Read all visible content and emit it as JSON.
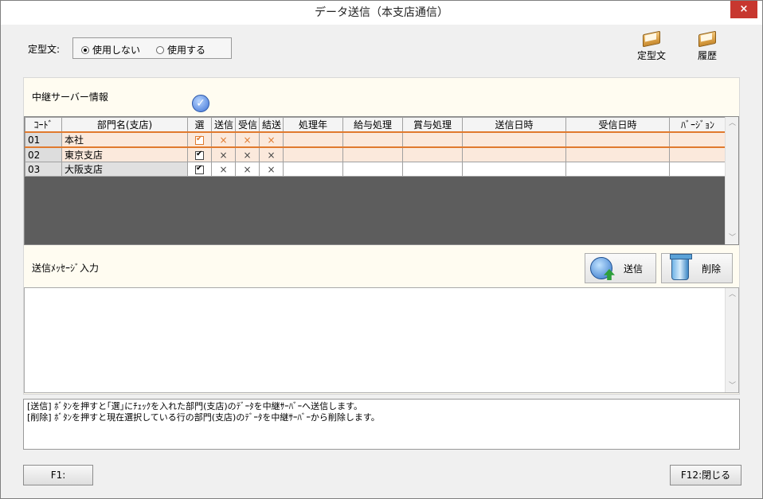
{
  "window": {
    "title": "データ送信（本支店通信）",
    "close": "×"
  },
  "teikei": {
    "label": "定型文:",
    "options": [
      {
        "label": "使用しない",
        "selected": true
      },
      {
        "label": "使用する",
        "selected": false
      }
    ]
  },
  "toolbar": {
    "template_label": "定型文",
    "history_label": "履歴"
  },
  "relay": {
    "title": "中継サーバー情報",
    "columns": [
      "ｺｰﾄﾞ",
      "部門名(支店)",
      "選",
      "送信",
      "受信",
      "結送",
      "処理年",
      "給与処理",
      "賞与処理",
      "送信日時",
      "受信日時",
      "ﾊﾞｰｼﾞｮﾝ"
    ],
    "rows": [
      {
        "code": "01",
        "name": "本社",
        "sel": true,
        "send": "×",
        "recv": "×",
        "result": "×",
        "year": "",
        "salary": "",
        "bonus": "",
        "sent_at": "",
        "recv_at": "",
        "version": ""
      },
      {
        "code": "02",
        "name": "東京支店",
        "sel": true,
        "send": "×",
        "recv": "×",
        "result": "×",
        "year": "",
        "salary": "",
        "bonus": "",
        "sent_at": "",
        "recv_at": "",
        "version": ""
      },
      {
        "code": "03",
        "name": "大阪支店",
        "sel": true,
        "send": "×",
        "recv": "×",
        "result": "×",
        "year": "",
        "salary": "",
        "bonus": "",
        "sent_at": "",
        "recv_at": "",
        "version": ""
      }
    ]
  },
  "message": {
    "title": "送信ﾒｯｾｰｼﾞ入力",
    "value": ""
  },
  "actions": {
    "send_label": "送信",
    "delete_label": "削除"
  },
  "info": {
    "line1": "[送信] ﾎﾞﾀﾝを押すと｢選｣にﾁｪｯｸを入れた部門(支店)のﾃﾞｰﾀを中継ｻｰﾊﾞｰへ送信します。",
    "line2": "[削除] ﾎﾞﾀﾝを押すと現在選択している行の部門(支店)のﾃﾞｰﾀを中継ｻｰﾊﾞｰから削除します。"
  },
  "footer": {
    "f1": "F1:",
    "f12": "F12:閉じる"
  },
  "colors": {
    "accent": "#e07a2e",
    "grid_bg": "#5d5d5d",
    "panel_bg": "#fffcf1"
  }
}
